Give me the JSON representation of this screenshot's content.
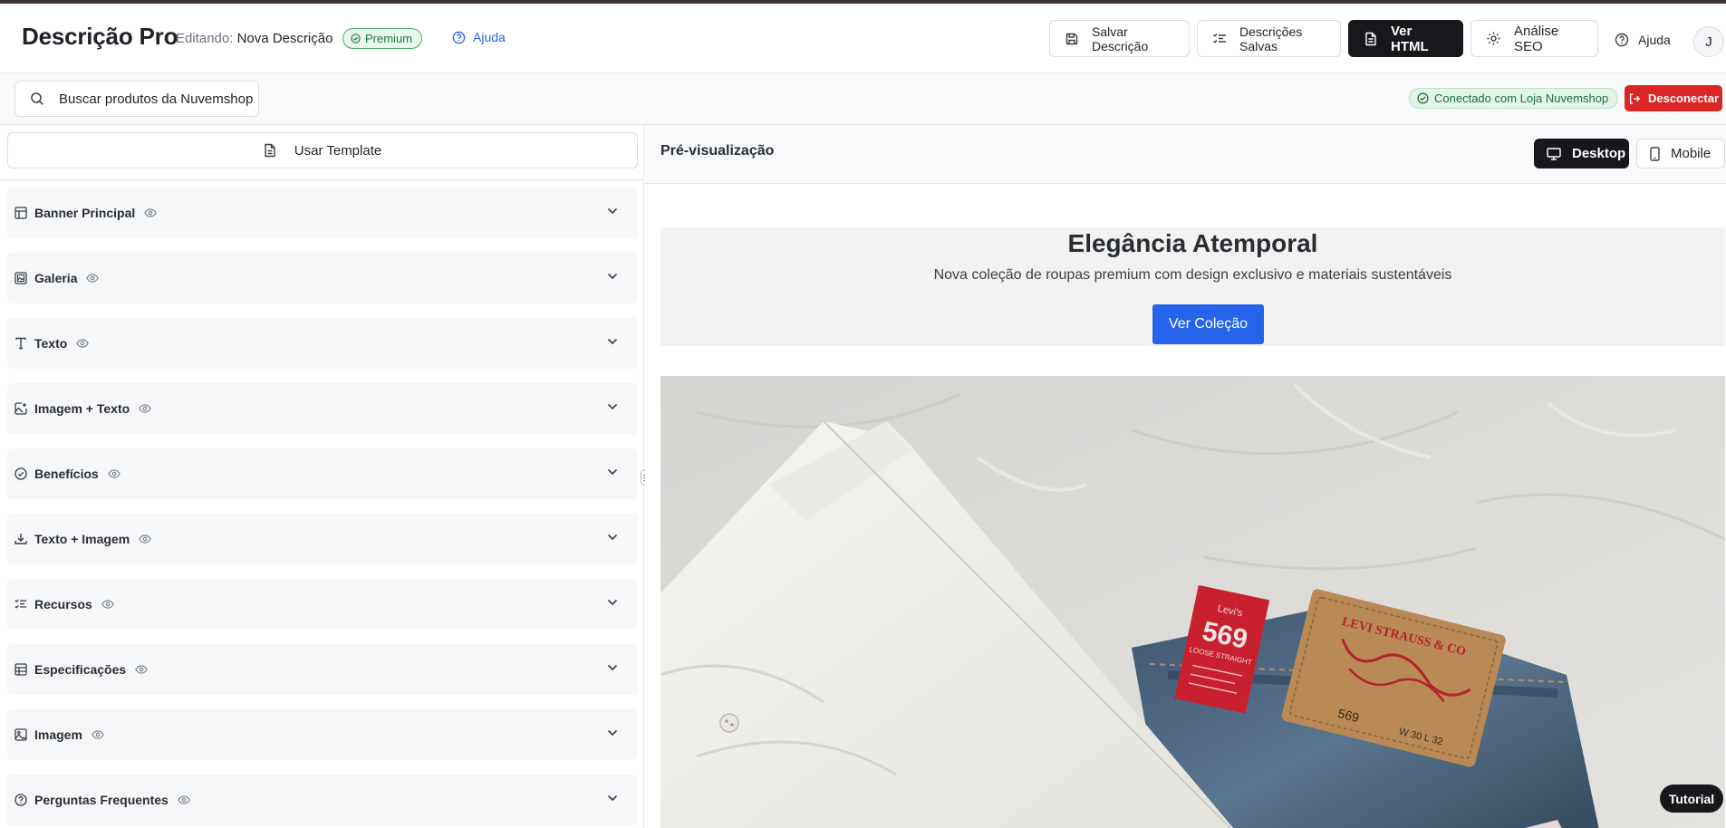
{
  "header": {
    "brand": "Descrição Pro",
    "editing_label": "Editando:",
    "editing_name": "Nova Descrição",
    "badge": "Premium",
    "help_link": "Ajuda",
    "buttons": {
      "save": "Salvar Descrição",
      "saved": "Descrições Salvas",
      "html": "Ver HTML",
      "seo": "Análise SEO",
      "help": "Ajuda"
    },
    "avatar_initial": "J"
  },
  "subbar": {
    "search_label": "Buscar produtos da Nuvemshop",
    "status": "Conectado com Loja Nuvemshop",
    "disconnect": "Desconectar"
  },
  "editor": {
    "template_button": "Usar Template",
    "sections": [
      {
        "label": "Banner Principal",
        "icon": "layout-icon"
      },
      {
        "label": "Galeria",
        "icon": "gallery-icon"
      },
      {
        "label": "Texto",
        "icon": "text-icon"
      },
      {
        "label": "Imagem + Texto",
        "icon": "image-plus-icon"
      },
      {
        "label": "Benefícios",
        "icon": "check-circle-icon"
      },
      {
        "label": "Texto + Imagem",
        "icon": "download-icon"
      },
      {
        "label": "Recursos",
        "icon": "list-check-icon"
      },
      {
        "label": "Especificações",
        "icon": "table-icon"
      },
      {
        "label": "Imagem",
        "icon": "image-icon"
      },
      {
        "label": "Perguntas Frequentes",
        "icon": "help-circle-icon"
      }
    ]
  },
  "preview": {
    "title": "Pré-visualização",
    "desktop": "Desktop",
    "mobile": "Mobile",
    "hero_title": "Elegância Atemporal",
    "hero_subtitle": "Nova coleção de roupas premium com design exclusivo e materiais sustentáveis",
    "hero_cta": "Ver Coleção",
    "photo_label": {
      "tag_number": "569",
      "tag_sub": "LOOSE STRAIGHT",
      "patch_brand": "LEVI STRAUSS & CO",
      "patch_size": "W 30 L 32"
    }
  },
  "tutorial": "Tutorial",
  "colors": {
    "accent_blue": "#2563eb",
    "danger_red": "#dc2626",
    "dark": "#16181b",
    "success_green": "#217a43"
  }
}
